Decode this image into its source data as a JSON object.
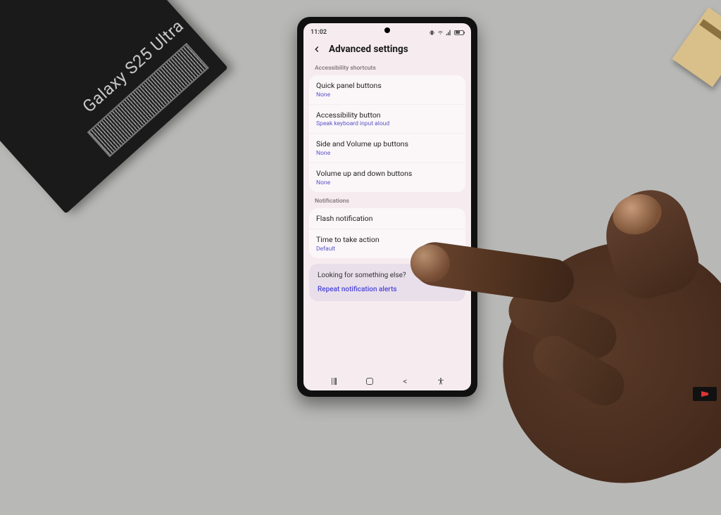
{
  "environment": {
    "box_label": "Galaxy S25 Ultra"
  },
  "statusbar": {
    "time": "11:02"
  },
  "header": {
    "title": "Advanced settings"
  },
  "sections": {
    "shortcuts": {
      "label": "Accessibility shortcuts",
      "items": [
        {
          "title": "Quick panel buttons",
          "sub": "None"
        },
        {
          "title": "Accessibility button",
          "sub": "Speak keyboard input aloud"
        },
        {
          "title": "Side and Volume up buttons",
          "sub": "None"
        },
        {
          "title": "Volume up and down buttons",
          "sub": "None"
        }
      ]
    },
    "notifications": {
      "label": "Notifications",
      "items": [
        {
          "title": "Flash notification",
          "sub": ""
        },
        {
          "title": "Time to take action",
          "sub": "Default"
        }
      ]
    }
  },
  "suggestion": {
    "heading": "Looking for something else?",
    "link": "Repeat notification alerts"
  }
}
